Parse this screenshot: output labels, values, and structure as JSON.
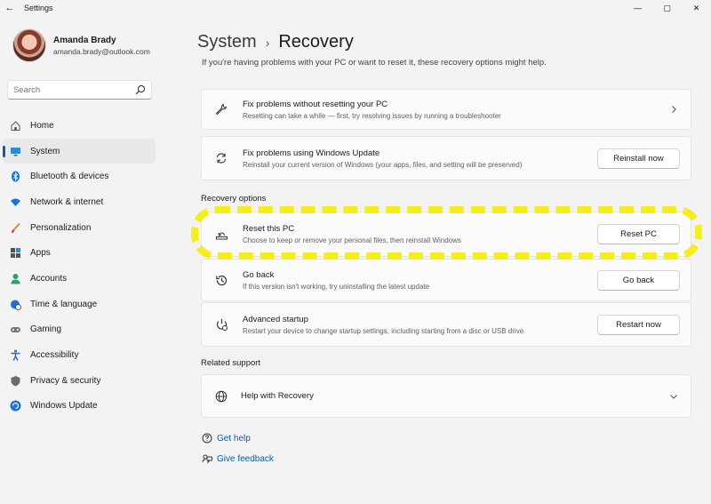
{
  "window": {
    "title": "Settings",
    "back_glyph": "←",
    "minimize_glyph": "—",
    "maximize_glyph": "▢",
    "close_glyph": "✕"
  },
  "profile": {
    "name": "Amanda Brady",
    "email": "amanda.brady@outlook.com"
  },
  "search": {
    "placeholder": "Search"
  },
  "sidebar": {
    "items": [
      {
        "label": "Home",
        "icon": "home-icon"
      },
      {
        "label": "System",
        "icon": "system-icon",
        "active": true
      },
      {
        "label": "Bluetooth & devices",
        "icon": "bluetooth-icon"
      },
      {
        "label": "Network & internet",
        "icon": "wifi-icon"
      },
      {
        "label": "Personalization",
        "icon": "brush-icon"
      },
      {
        "label": "Apps",
        "icon": "apps-icon"
      },
      {
        "label": "Accounts",
        "icon": "accounts-icon"
      },
      {
        "label": "Time & language",
        "icon": "globe-clock-icon"
      },
      {
        "label": "Gaming",
        "icon": "gamepad-icon"
      },
      {
        "label": "Accessibility",
        "icon": "accessibility-icon"
      },
      {
        "label": "Privacy & security",
        "icon": "shield-icon"
      },
      {
        "label": "Windows Update",
        "icon": "update-icon"
      }
    ]
  },
  "header": {
    "parent": "System",
    "separator": "›",
    "current": "Recovery",
    "subtitle": "If you're having problems with your PC or want to reset it, these recovery options might help."
  },
  "cards": {
    "fix_without_reset": {
      "title": "Fix problems without resetting your PC",
      "desc": "Resetting can take a while — first, try resolving issues by running a troubleshooter"
    },
    "fix_windows_update": {
      "title": "Fix problems using Windows Update",
      "desc": "Reinstall your current version of Windows (your apps, files, and setting will be preserved)",
      "button": "Reinstall now"
    }
  },
  "recovery_options": {
    "title": "Recovery options",
    "reset": {
      "title": "Reset this PC",
      "desc": "Choose to keep or remove your personal files, then reinstall Windows",
      "button": "Reset PC"
    },
    "go_back": {
      "title": "Go back",
      "desc": "If this version isn't working, try uninstalling the latest update",
      "button": "Go back"
    },
    "advanced": {
      "title": "Advanced startup",
      "desc": "Restart your device to change startup settings, including starting from a disc or USB drive",
      "button": "Restart now"
    }
  },
  "related_support": {
    "title": "Related support",
    "help": "Help with Recovery"
  },
  "links": {
    "get_help": "Get help",
    "give_feedback": "Give feedback"
  },
  "colors": {
    "accent": "#005fb8",
    "highlight": "#f5ee1a",
    "background": "#f3f3f3",
    "card": "#fbfbfb"
  }
}
